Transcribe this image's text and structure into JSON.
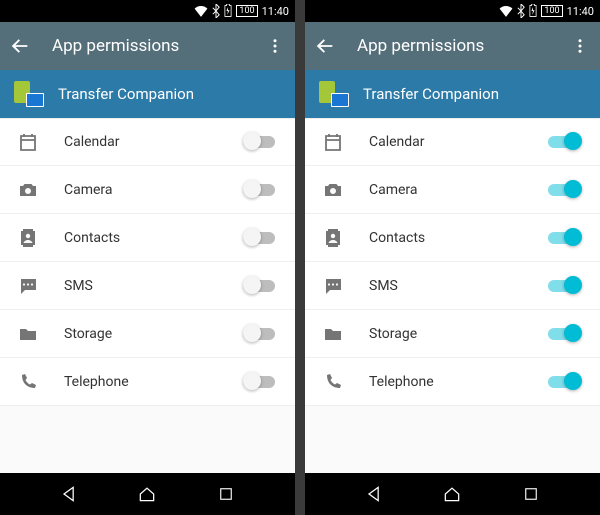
{
  "status": {
    "battery": "100",
    "time": "11:40"
  },
  "appbar": {
    "title": "App permissions"
  },
  "app": {
    "name": "Transfer Companion"
  },
  "permissions": [
    {
      "icon": "calendar-icon",
      "label": "Calendar"
    },
    {
      "icon": "camera-icon",
      "label": "Camera"
    },
    {
      "icon": "contacts-icon",
      "label": "Contacts"
    },
    {
      "icon": "sms-icon",
      "label": "SMS"
    },
    {
      "icon": "storage-icon",
      "label": "Storage"
    },
    {
      "icon": "telephone-icon",
      "label": "Telephone"
    }
  ],
  "screens": [
    {
      "toggles": [
        false,
        false,
        false,
        false,
        false,
        false
      ]
    },
    {
      "toggles": [
        true,
        true,
        true,
        true,
        true,
        true
      ]
    }
  ]
}
